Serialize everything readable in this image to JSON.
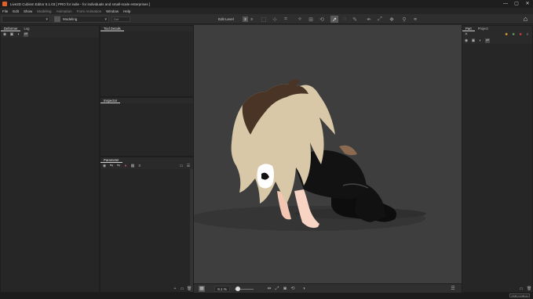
{
  "window": {
    "title": "Live2D Cubism Editor 5.1.03   [ PRO for indie - for individuals and small-scale enterprises ]",
    "controls": [
      "—",
      "▢",
      "✕"
    ]
  },
  "menu": [
    "File",
    "Edit",
    "Show",
    "Modeling",
    "Animation",
    "Form Animation",
    "Window",
    "Help"
  ],
  "toolbar": {
    "mode_label": "Modeling",
    "small_dropdown": "Def",
    "edit_level_label": "Edit Level",
    "levels": [
      "2",
      "3"
    ]
  },
  "left_panel": {
    "tabs": [
      "Deformer",
      "Log"
    ]
  },
  "tool_details": {
    "tab": "Tool Details"
  },
  "inspector": {
    "tab": "Inspector"
  },
  "parameter": {
    "tab": "Parameter"
  },
  "right_panel": {
    "tabs": [
      "Part",
      "Project"
    ]
  },
  "status": {
    "zoom": "9.1 %"
  },
  "bottom": {
    "info": "1,111 x 1,111 px"
  }
}
